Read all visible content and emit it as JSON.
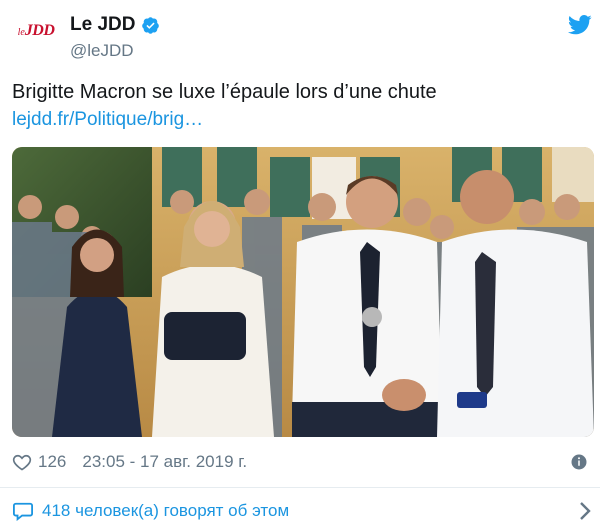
{
  "account": {
    "display_name": "Le JDD",
    "handle": "@leJDD",
    "avatar_logo": {
      "le": "le",
      "jdd": "JDD"
    },
    "verified": true
  },
  "tweet": {
    "text": "Brigitte Macron se luxe l’épaule lors d’une chute",
    "link": "lejdd.fr/Politique/brig…"
  },
  "footer": {
    "likes": "126",
    "timestamp": "23:05 - 17 авг. 2019 г.",
    "talking": "418 человек(а) говорят об этом"
  },
  "icons": [
    "verified-badge-icon",
    "twitter-bird-icon",
    "heart-icon",
    "info-icon",
    "comment-icon",
    "chevron-right-icon"
  ],
  "colors": {
    "brand_blue": "#1da1f2",
    "link_blue": "#1b95e0",
    "secondary_text": "#657786",
    "logo_red": "#c8102e"
  }
}
